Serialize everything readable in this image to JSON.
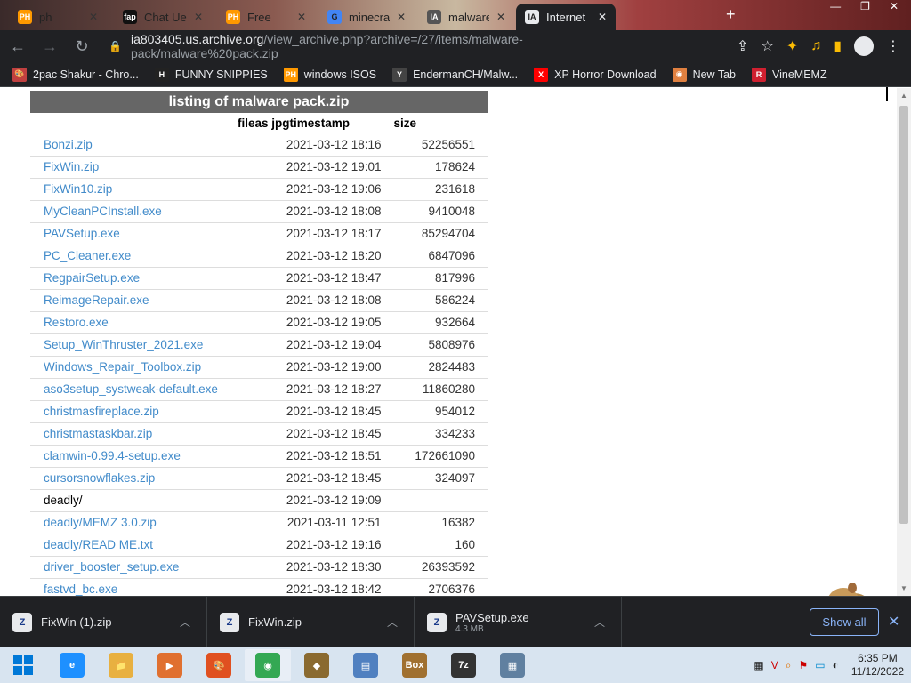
{
  "browser": {
    "tabs": [
      {
        "label": "ph",
        "icon": "PH",
        "icon_color": "#ff9900"
      },
      {
        "label": "Chat Ue",
        "icon": "fap",
        "icon_color": "#111111"
      },
      {
        "label": "Free",
        "icon": "PH",
        "icon_color": "#ff9900"
      },
      {
        "label": "minecra",
        "icon": "G",
        "icon_color": "#4285f4"
      },
      {
        "label": "malware",
        "icon": "IA",
        "icon_color": "#555555"
      },
      {
        "label": "Internet",
        "icon": "IA",
        "icon_color": "#e8eaed"
      }
    ],
    "url_host": "ia803405.us.archive.org",
    "url_path": "/view_archive.php?archive=/27/items/malware-pack/malware%20pack.zip",
    "bookmarks": [
      {
        "label": "2pac Shakur - Chro...",
        "icon": "🎨"
      },
      {
        "label": "FUNNY SNIPPIES",
        "icon": "H"
      },
      {
        "label": "windows ISOS",
        "icon": "PH"
      },
      {
        "label": "EndermanCH/Malw...",
        "icon": "Y"
      },
      {
        "label": "XP Horror Download",
        "icon": "X"
      },
      {
        "label": "New Tab",
        "icon": "◉"
      },
      {
        "label": "VineMEMZ",
        "icon": "R"
      }
    ]
  },
  "listing": {
    "caption": "listing of malware pack.zip",
    "headers": {
      "file": "file",
      "timestamp": "as jpgtimestamp",
      "size": "size"
    },
    "rows": [
      {
        "file": "Bonzi.zip",
        "date": "2021-03-12 18:16",
        "size": "52256551",
        "link": true
      },
      {
        "file": "FixWin.zip",
        "date": "2021-03-12 19:01",
        "size": "178624",
        "link": true
      },
      {
        "file": "FixWin10.zip",
        "date": "2021-03-12 19:06",
        "size": "231618",
        "link": true
      },
      {
        "file": "MyCleanPCInstall.exe",
        "date": "2021-03-12 18:08",
        "size": "9410048",
        "link": true
      },
      {
        "file": "PAVSetup.exe",
        "date": "2021-03-12 18:17",
        "size": "85294704",
        "link": true
      },
      {
        "file": "PC_Cleaner.exe",
        "date": "2021-03-12 18:20",
        "size": "6847096",
        "link": true
      },
      {
        "file": "RegpairSetup.exe",
        "date": "2021-03-12 18:47",
        "size": "817996",
        "link": true
      },
      {
        "file": "ReimageRepair.exe",
        "date": "2021-03-12 18:08",
        "size": "586224",
        "link": true
      },
      {
        "file": "Restoro.exe",
        "date": "2021-03-12 19:05",
        "size": "932664",
        "link": true
      },
      {
        "file": "Setup_WinThruster_2021.exe",
        "date": "2021-03-12 19:04",
        "size": "5808976",
        "link": true
      },
      {
        "file": "Windows_Repair_Toolbox.zip",
        "date": "2021-03-12 19:00",
        "size": "2824483",
        "link": true
      },
      {
        "file": "aso3setup_systweak-default.exe",
        "date": "2021-03-12 18:27",
        "size": "11860280",
        "link": true
      },
      {
        "file": "christmasfireplace.zip",
        "date": "2021-03-12 18:45",
        "size": "954012",
        "link": true
      },
      {
        "file": "christmastaskbar.zip",
        "date": "2021-03-12 18:45",
        "size": "334233",
        "link": true
      },
      {
        "file": "clamwin-0.99.4-setup.exe",
        "date": "2021-03-12 18:51",
        "size": "172661090",
        "link": true
      },
      {
        "file": "cursorsnowflakes.zip",
        "date": "2021-03-12 18:45",
        "size": "324097",
        "link": true
      },
      {
        "file": "deadly/",
        "date": "2021-03-12 19:09",
        "size": "",
        "link": false
      },
      {
        "file": "deadly/MEMZ 3.0.zip",
        "date": "2021-03-11 12:51",
        "size": "16382",
        "link": true
      },
      {
        "file": "deadly/READ ME.txt",
        "date": "2021-03-12 19:16",
        "size": "160",
        "link": true
      },
      {
        "file": "driver_booster_setup.exe",
        "date": "2021-03-12 18:30",
        "size": "26393592",
        "link": true
      },
      {
        "file": "fastvd_bc.exe",
        "date": "2021-03-12 18:42",
        "size": "2706376",
        "link": true
      }
    ]
  },
  "downloads": {
    "items": [
      {
        "name": "FixWin (1).zip",
        "sub": ""
      },
      {
        "name": "FixWin.zip",
        "sub": ""
      },
      {
        "name": "PAVSetup.exe",
        "sub": "4.3 MB"
      }
    ],
    "show_all": "Show all"
  },
  "taskbar": {
    "apps": [
      {
        "name": "internet-explorer",
        "label": "e",
        "color": "#1e90ff"
      },
      {
        "name": "file-explorer",
        "label": "📁",
        "color": "#e8b040"
      },
      {
        "name": "media-player",
        "label": "▶",
        "color": "#e07030"
      },
      {
        "name": "paint",
        "label": "🎨",
        "color": "#e05020"
      },
      {
        "name": "chrome",
        "label": "◉",
        "color": "#34a853"
      },
      {
        "name": "app-one",
        "label": "◆",
        "color": "#8a6a30"
      },
      {
        "name": "notepad",
        "label": "▤",
        "color": "#5080c0"
      },
      {
        "name": "box",
        "label": "Box",
        "color": "#a07030"
      },
      {
        "name": "7zip",
        "label": "7z",
        "color": "#333333"
      },
      {
        "name": "control-panel",
        "label": "▦",
        "color": "#6080a0"
      }
    ],
    "time": "6:35 PM",
    "date": "11/12/2022"
  }
}
